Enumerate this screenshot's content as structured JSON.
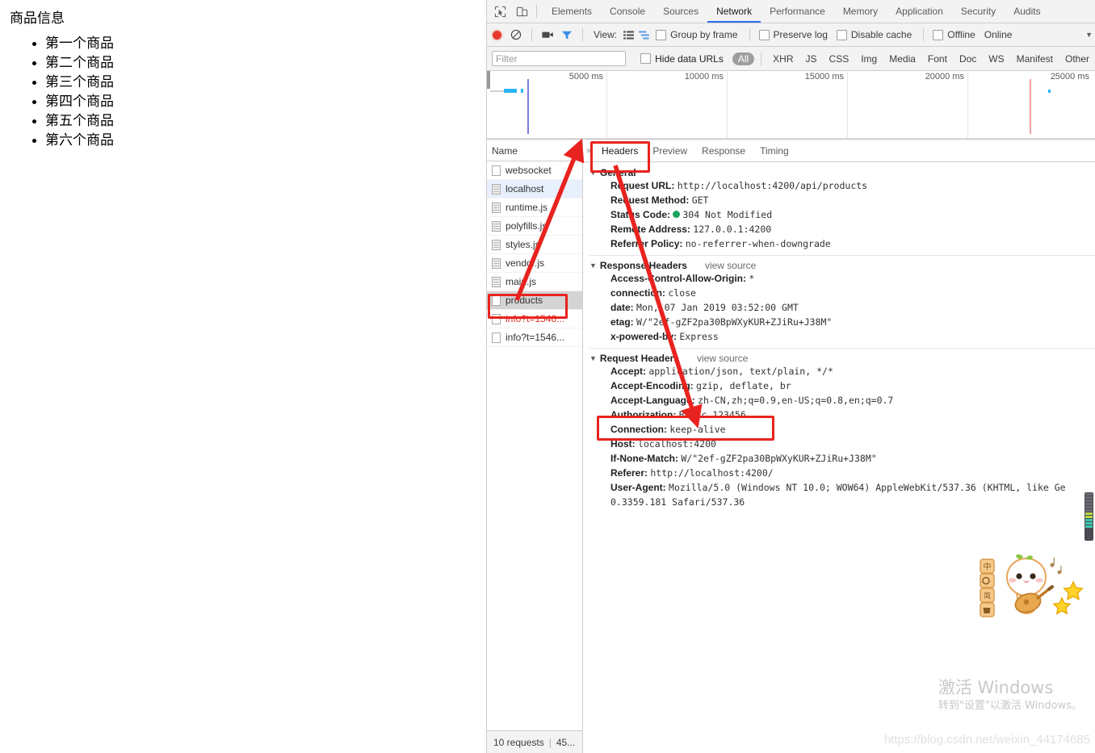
{
  "page": {
    "title": "商品信息",
    "items": [
      "第一个商品",
      "第二个商品",
      "第三个商品",
      "第四个商品",
      "第五个商品",
      "第六个商品"
    ]
  },
  "devtools": {
    "icons": {
      "inspect": "inspect-element-icon",
      "device": "device-toolbar-icon",
      "overflow": "more-tabs-icon"
    },
    "tabs": [
      {
        "label": "Elements",
        "active": false
      },
      {
        "label": "Console",
        "active": false
      },
      {
        "label": "Sources",
        "active": false
      },
      {
        "label": "Network",
        "active": true
      },
      {
        "label": "Performance",
        "active": false
      },
      {
        "label": "Memory",
        "active": false
      },
      {
        "label": "Application",
        "active": false
      },
      {
        "label": "Security",
        "active": false
      },
      {
        "label": "Audits",
        "active": false
      }
    ],
    "controls": {
      "record_title": "record-button",
      "clear_title": "clear-button",
      "screenshot_title": "capture-screenshots-icon",
      "filter_title": "filter-icon",
      "view_label": "View:",
      "view_list_icon": "list-view-icon",
      "view_waterfall_icon": "waterfall-view-icon",
      "group_by_frame": "Group by frame",
      "preserve_log": "Preserve log",
      "disable_cache": "Disable cache",
      "offline": "Offline",
      "online": "Online"
    },
    "filterbar": {
      "placeholder": "Filter",
      "value": "",
      "hide_data_urls": "Hide data URLs",
      "types": [
        {
          "label": "All",
          "active": true
        },
        {
          "label": "XHR",
          "active": false
        },
        {
          "label": "JS",
          "active": false
        },
        {
          "label": "CSS",
          "active": false
        },
        {
          "label": "Img",
          "active": false
        },
        {
          "label": "Media",
          "active": false
        },
        {
          "label": "Font",
          "active": false
        },
        {
          "label": "Doc",
          "active": false
        },
        {
          "label": "WS",
          "active": false
        },
        {
          "label": "Manifest",
          "active": false
        },
        {
          "label": "Other",
          "active": false
        }
      ]
    },
    "timeline": {
      "ticks": [
        "5000 ms",
        "10000 ms",
        "15000 ms",
        "20000 ms",
        "25000 ms"
      ]
    },
    "requests": {
      "header": "Name",
      "rows": [
        {
          "name": "websocket",
          "icon": "plain",
          "state": "normal"
        },
        {
          "name": "localhost",
          "icon": "doc",
          "state": "blue"
        },
        {
          "name": "runtime.js",
          "icon": "doc",
          "state": "normal"
        },
        {
          "name": "polyfills.js",
          "icon": "doc",
          "state": "normal"
        },
        {
          "name": "styles.js",
          "icon": "doc",
          "state": "normal"
        },
        {
          "name": "vendor.js",
          "icon": "doc",
          "state": "normal"
        },
        {
          "name": "main.js",
          "icon": "doc",
          "state": "normal"
        },
        {
          "name": "products",
          "icon": "plain",
          "state": "selected"
        },
        {
          "name": "info?t=1546...",
          "icon": "plain",
          "state": "error"
        },
        {
          "name": "info?t=1546...",
          "icon": "plain",
          "state": "normal"
        }
      ],
      "status_requests": "10 requests",
      "status_transferred": "45..."
    },
    "detail": {
      "tabs": [
        {
          "label": "Headers",
          "active": true
        },
        {
          "label": "Preview",
          "active": false
        },
        {
          "label": "Response",
          "active": false
        },
        {
          "label": "Timing",
          "active": false
        }
      ],
      "general": {
        "title": "General",
        "rows": [
          {
            "key": "Request URL:",
            "value": "http://localhost:4200/api/products",
            "dot": false
          },
          {
            "key": "Request Method:",
            "value": "GET",
            "dot": false
          },
          {
            "key": "Status Code:",
            "value": "304 Not Modified",
            "dot": true
          },
          {
            "key": "Remote Address:",
            "value": "127.0.0.1:4200",
            "dot": false
          },
          {
            "key": "Referrer Policy:",
            "value": "no-referrer-when-downgrade",
            "dot": false
          }
        ]
      },
      "response_headers": {
        "title": "Response Headers",
        "view_source": "view source",
        "rows": [
          {
            "key": "Access-Control-Allow-Origin:",
            "value": "*"
          },
          {
            "key": "connection:",
            "value": "close"
          },
          {
            "key": "date:",
            "value": "Mon, 07 Jan 2019 03:52:00 GMT"
          },
          {
            "key": "etag:",
            "value": "W/\"2ef-gZF2pa30BpWXyKUR+ZJiRu+J38M\""
          },
          {
            "key": "x-powered-by:",
            "value": "Express"
          }
        ]
      },
      "request_headers": {
        "title": "Request Headers",
        "view_source": "view source",
        "rows": [
          {
            "key": "Accept:",
            "value": "application/json, text/plain, */*"
          },
          {
            "key": "Accept-Encoding:",
            "value": "gzip, deflate, br"
          },
          {
            "key": "Accept-Language:",
            "value": "zh-CN,zh;q=0.9,en-US;q=0.8,en;q=0.7"
          },
          {
            "key": "Authorization:",
            "value": "Basic 123456"
          },
          {
            "key": "Connection:",
            "value": "keep-alive"
          },
          {
            "key": "Host:",
            "value": "localhost:4200"
          },
          {
            "key": "If-None-Match:",
            "value": "W/\"2ef-gZF2pa30BpWXyKUR+ZJiRu+J38M\""
          },
          {
            "key": "Referer:",
            "value": "http://localhost:4200/"
          },
          {
            "key": "User-Agent:",
            "value": "Mozilla/5.0 (Windows NT 10.0; WOW64) AppleWebKit/537.36 (KHTML, like Ge"
          },
          {
            "key": "",
            "value": "0.3359.181 Safari/537.36"
          }
        ]
      }
    }
  },
  "watermarks": {
    "windows_title": "激活 Windows",
    "windows_sub": "转到\"设置\"以激活 Windows。",
    "blog_url": "https://blog.csdn.net/weixin_44174685"
  },
  "annotations": {
    "headers_tab_box": "headers-tab-highlight",
    "products_row_box": "products-row-highlight",
    "authorization_box": "authorization-header-highlight",
    "arrow_to_products": "arrow-pointing-to-products-row",
    "arrow_to_authorization": "arrow-pointing-to-authorization"
  },
  "colors": {
    "accent": "#2d6ff0",
    "record": "#e8392c",
    "annotation": "#e8231f",
    "error_text": "#d93025",
    "status_ok": "#1aa260"
  }
}
